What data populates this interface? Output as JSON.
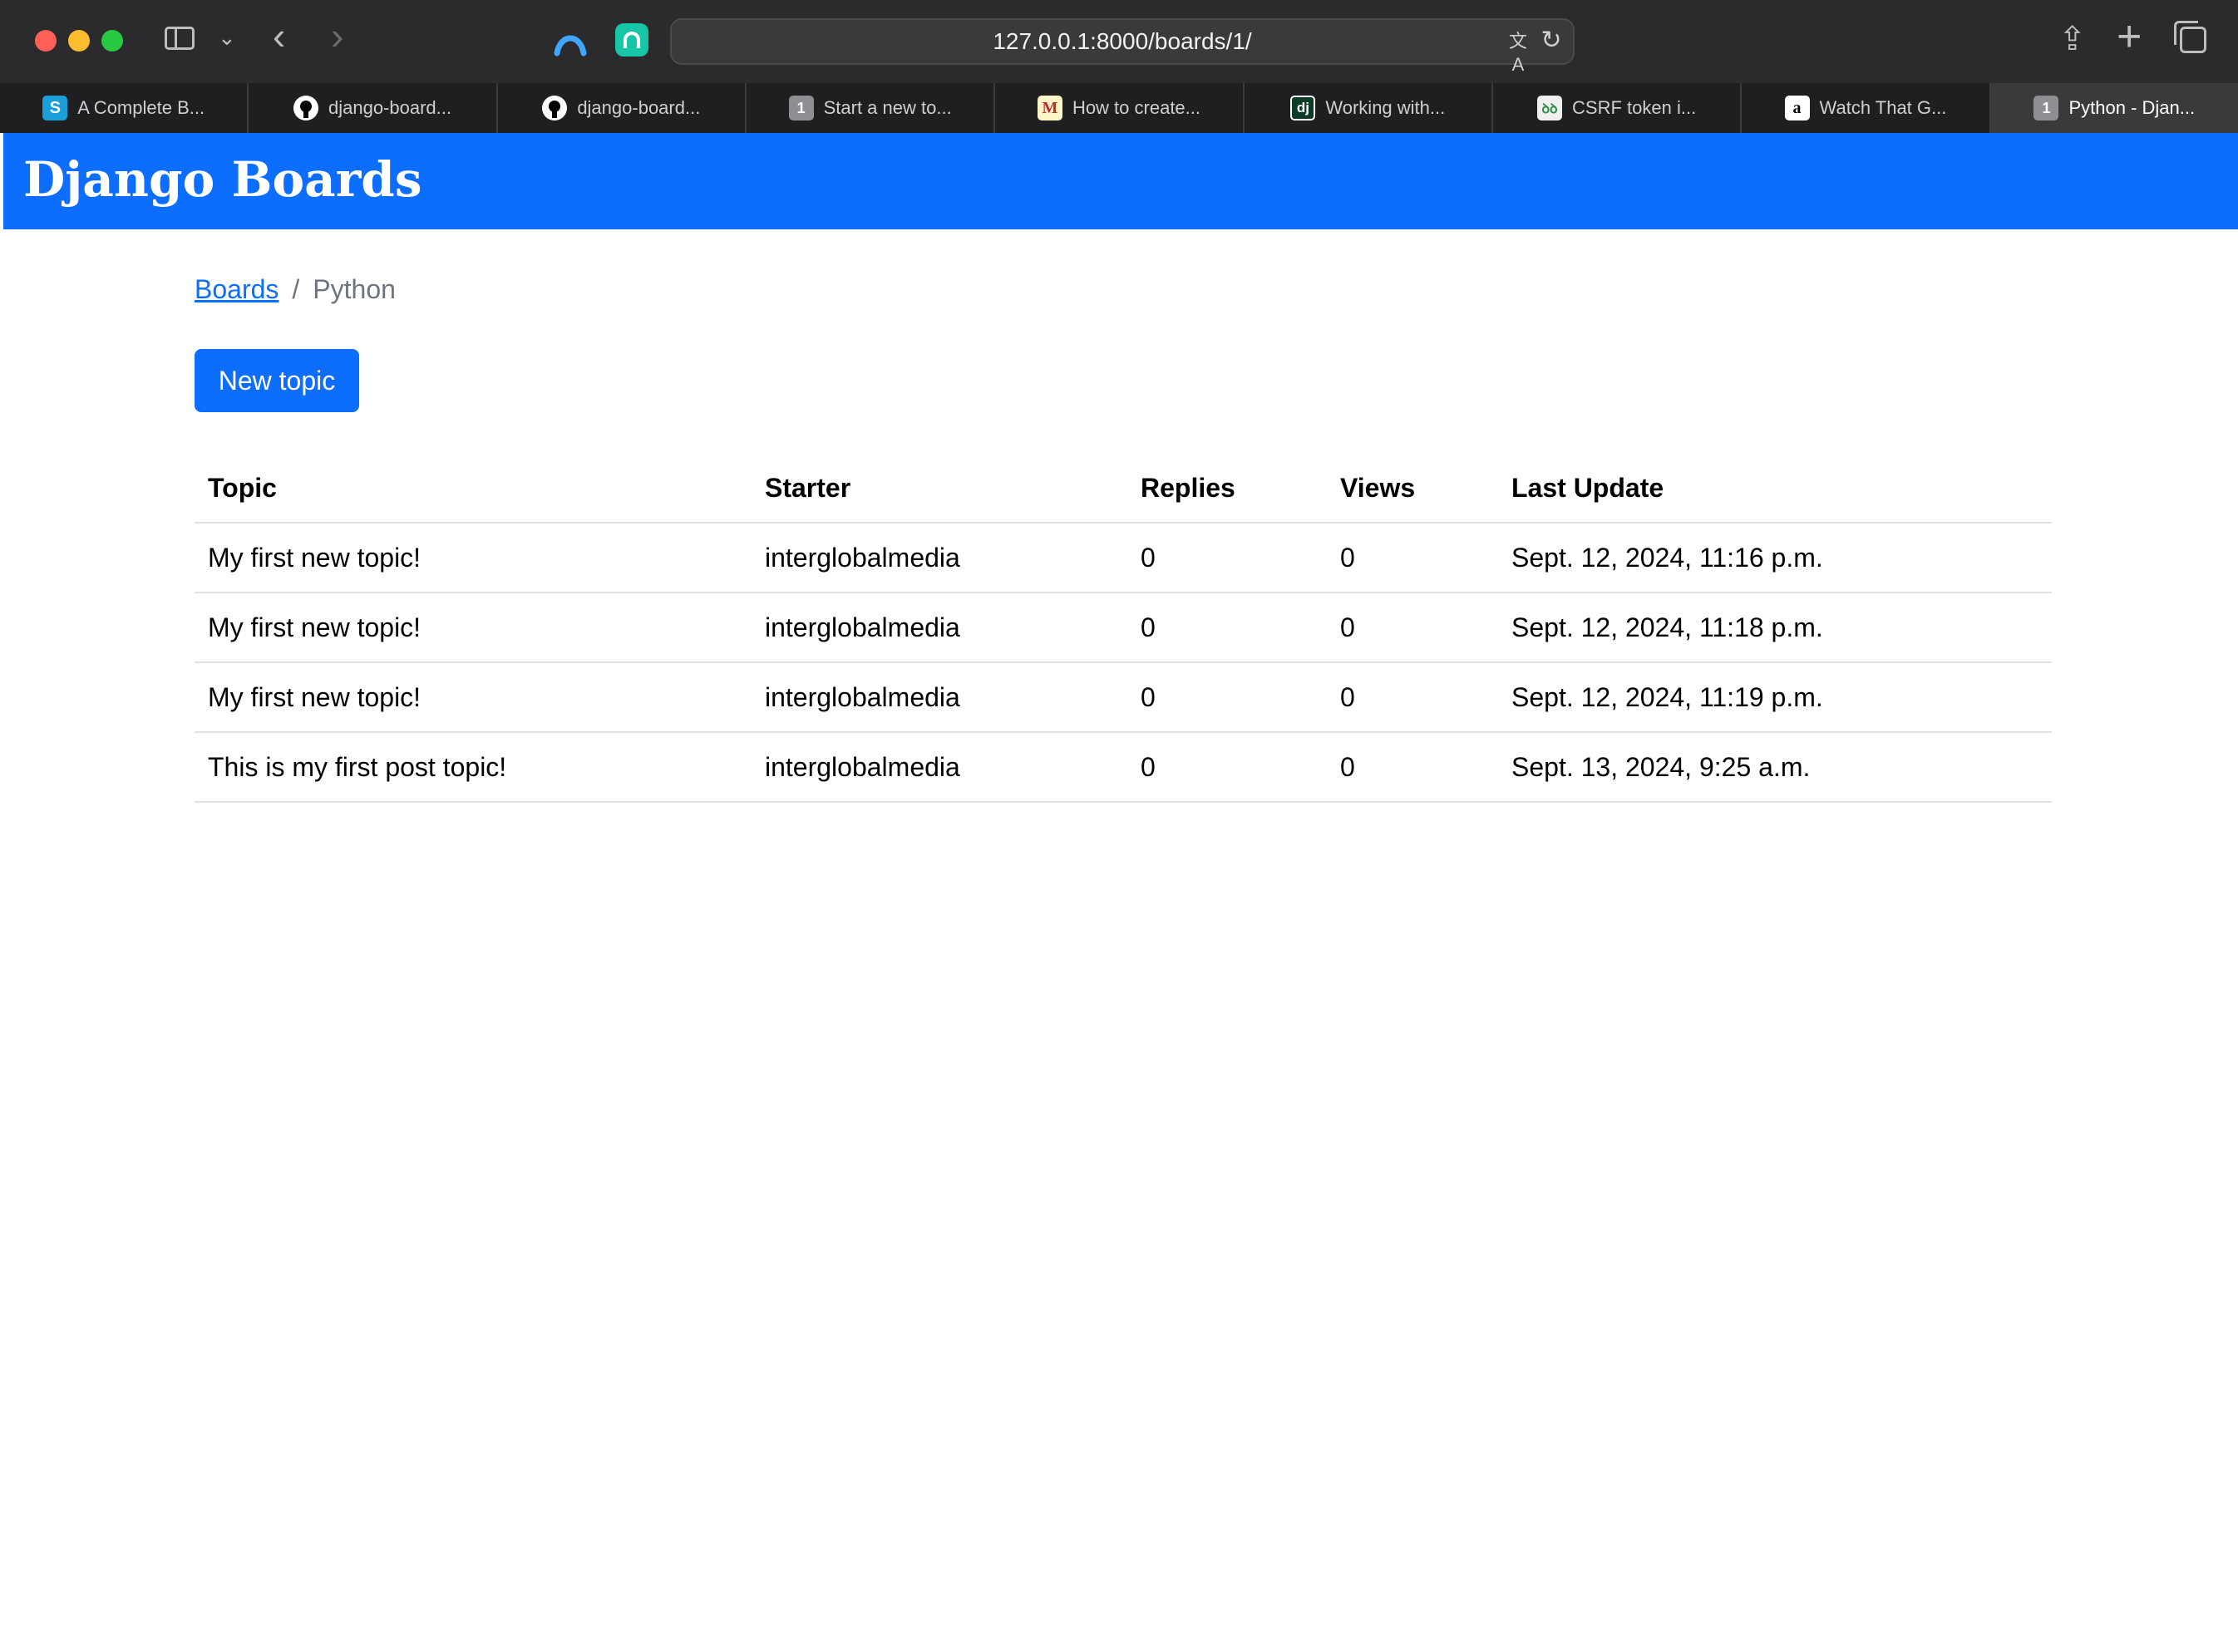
{
  "browser": {
    "url": "127.0.0.1:8000/boards/1/",
    "tabs": [
      {
        "label": "A Complete B...",
        "favicon": "S",
        "icon": "s-favicon"
      },
      {
        "label": "django-board...",
        "favicon": "",
        "icon": "github-icon"
      },
      {
        "label": "django-board...",
        "favicon": "",
        "icon": "github-icon"
      },
      {
        "label": "Start a new to...",
        "favicon": "1",
        "icon": "number-favicon"
      },
      {
        "label": "How to create...",
        "favicon": "M",
        "icon": "medium-favicon"
      },
      {
        "label": "Working with...",
        "favicon": "dj",
        "icon": "django-favicon"
      },
      {
        "label": "CSRF token i...",
        "favicon": "",
        "icon": "geeksforgeeks-favicon"
      },
      {
        "label": "Watch That G...",
        "favicon": "a",
        "icon": "a-favicon"
      },
      {
        "label": "Python - Djan...",
        "favicon": "1",
        "icon": "number-favicon",
        "active": true
      }
    ]
  },
  "navbar": {
    "brand": "Django Boards"
  },
  "breadcrumb": {
    "root": "Boards",
    "separator": "/",
    "current": "Python"
  },
  "actions": {
    "new_topic": "New topic"
  },
  "table": {
    "headers": [
      "Topic",
      "Starter",
      "Replies",
      "Views",
      "Last Update"
    ],
    "rows": [
      [
        "My first new topic!",
        "interglobalmedia",
        "0",
        "0",
        "Sept. 12, 2024, 11:16 p.m."
      ],
      [
        "My first new topic!",
        "interglobalmedia",
        "0",
        "0",
        "Sept. 12, 2024, 11:18 p.m."
      ],
      [
        "My first new topic!",
        "interglobalmedia",
        "0",
        "0",
        "Sept. 12, 2024, 11:19 p.m."
      ],
      [
        "This is my first post topic!",
        "interglobalmedia",
        "0",
        "0",
        "Sept. 13, 2024, 9:25 a.m."
      ]
    ]
  },
  "colors": {
    "primary": "#0d6efd",
    "chrome": "#2b2b2d",
    "tabbar": "#1f1f21"
  }
}
